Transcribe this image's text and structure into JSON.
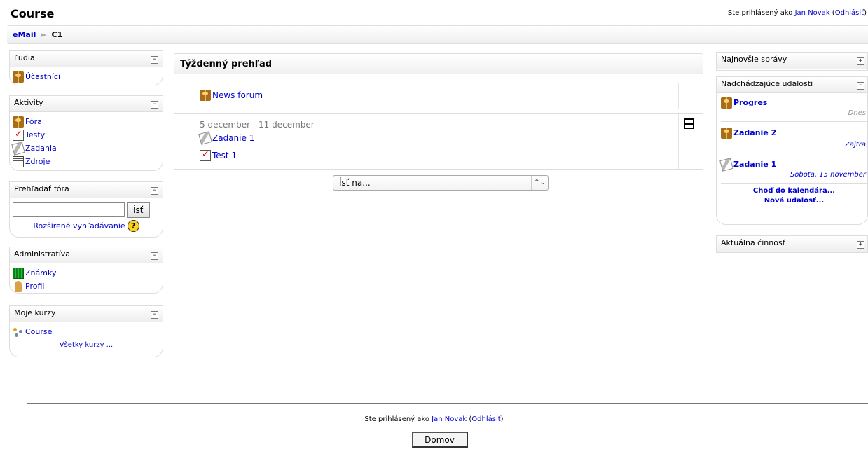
{
  "header": {
    "title": "Course",
    "login_prefix": "Ste prihlásený ako ",
    "user_name": "Jan Novak",
    "logout_open": " (",
    "logout": "Odhlásiť",
    "logout_close": ")"
  },
  "breadcrumb": {
    "root": "eMail",
    "separator": "►",
    "current": "C1"
  },
  "left_blocks": {
    "people": {
      "title": "Ľudia",
      "toggle": "−",
      "items": [
        "Účastníci"
      ]
    },
    "activities": {
      "title": "Aktivity",
      "toggle": "−",
      "items": [
        "Fóra",
        "Testy",
        "Zadania",
        "Zdroje"
      ]
    },
    "search": {
      "title": "Prehľadať fóra",
      "toggle": "−",
      "input_value": "",
      "button": "Ísť",
      "advanced": "Rozšírené vyhľadávanie",
      "help": "?"
    },
    "admin": {
      "title": "Administratíva",
      "toggle": "−",
      "items": [
        "Známky",
        "Profil"
      ]
    },
    "my_courses": {
      "title": "Moje kurzy",
      "toggle": "−",
      "items": [
        "Course"
      ],
      "all_courses": "Všetky kurzy ..."
    }
  },
  "main": {
    "heading": "Týždenný prehľad",
    "section0": {
      "link": "News forum"
    },
    "week1": {
      "dates": "5 december - 11 december",
      "items": [
        "Zadanie 1",
        "Test 1"
      ]
    },
    "jump": {
      "selected": "Ísť na...",
      "arrows": "⌃⌄"
    }
  },
  "right_blocks": {
    "news": {
      "title": "Najnovšie správy",
      "toggle": "+"
    },
    "upcoming": {
      "title": "Nadchádzajúce udalosti",
      "toggle": "−",
      "events": [
        {
          "name": "Progres",
          "when": "Dnes"
        },
        {
          "name": "Zadanie 2",
          "when": "Zajtra"
        },
        {
          "name": "Zadanie 1",
          "when": "Sobota, 15 november"
        }
      ],
      "calendar_link": "Choď do kalendára...",
      "new_event_link": "Nová udalosť..."
    },
    "recent": {
      "title": "Aktuálna činnosť",
      "toggle": "+"
    }
  },
  "footer": {
    "login_prefix": "Ste prihlásený ako ",
    "user_name": "Jan Novak",
    "logout_open": " (",
    "logout": "Odhlásiť",
    "logout_close": ")",
    "home_button": "Domov"
  },
  "icons": {
    "forum": "forum-icon",
    "quiz": "quiz-icon",
    "assignment": "assignment-icon",
    "resource": "resource-icon",
    "grades": "grades-icon",
    "profile": "profile-icon",
    "course": "course-icon",
    "help": "help-icon"
  },
  "colors": {
    "link": "#0000cc",
    "border": "#dddddd",
    "date_gray": "#777777"
  }
}
